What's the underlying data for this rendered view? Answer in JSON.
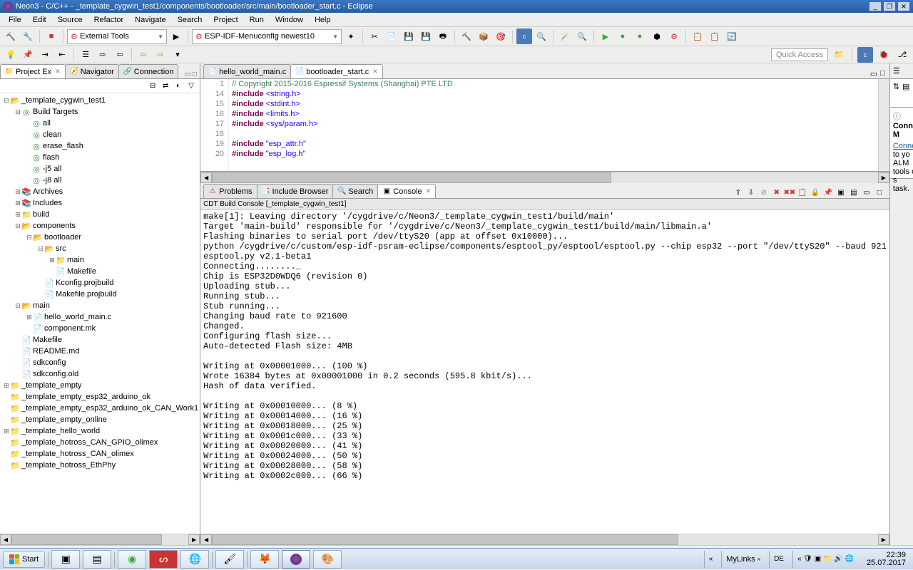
{
  "window": {
    "title": "Neon3 - C/C++ - _template_cygwin_test1/components/bootloader/src/main/bootloader_start.c - Eclipse"
  },
  "menu": [
    "File",
    "Edit",
    "Source",
    "Refactor",
    "Navigate",
    "Search",
    "Project",
    "Run",
    "Window",
    "Help"
  ],
  "toolbar": {
    "external_tools": "External Tools",
    "esp_config": "ESP-IDF-Menuconfig newest10",
    "quick_access": "Quick Access"
  },
  "left_tabs": {
    "project": "Project Ex",
    "navigator": "Navigator",
    "connection": "Connection"
  },
  "tree": {
    "root": "_template_cygwin_test1",
    "build_targets": "Build Targets",
    "targets": [
      "all",
      "clean",
      "erase_flash",
      "flash",
      "-j5 all",
      "-j8 all"
    ],
    "archives": "Archives",
    "includes": "Includes",
    "build": "build",
    "components": "components",
    "bootloader": "bootloader",
    "src": "src",
    "main_dir": "main",
    "makefile": "Makefile",
    "kconfig": "Kconfig.projbuild",
    "makefile_proj": "Makefile.projbuild",
    "main2": "main",
    "hello_c": "hello_world_main.c",
    "component_mk": "component.mk",
    "makefile2": "Makefile",
    "readme": "README.md",
    "sdkconfig": "sdkconfig",
    "sdkconfig_old": "sdkconfig.old",
    "projects": [
      "_template_empty",
      "_template_empty_esp32_arduino_ok",
      "_template_empty_esp32_arduino_ok_CAN_Work1",
      "_template_empty_online",
      "_template_hello_world",
      "_template_hotross_CAN_GPIO_olimex",
      "_template_hotross_CAN_olimex",
      "_template_hotross_EthPhy"
    ]
  },
  "editor_tabs": {
    "t1": "hello_world_main.c",
    "t2": "bootloader_start.c"
  },
  "editor": {
    "lines": [
      {
        "n": "1",
        "type": "cm",
        "text": "// Copyright 2015-2016 Espressif Systems (Shanghai) PTE LTD"
      },
      {
        "n": "14",
        "type": "inc",
        "kw": "#include",
        "arg": "<string.h>"
      },
      {
        "n": "15",
        "type": "inc",
        "kw": "#include",
        "arg": "<stdint.h>"
      },
      {
        "n": "16",
        "type": "inc",
        "kw": "#include",
        "arg": "<limits.h>"
      },
      {
        "n": "17",
        "type": "inc",
        "kw": "#include",
        "arg": "<sys/param.h>"
      },
      {
        "n": "18",
        "type": "blank",
        "text": ""
      },
      {
        "n": "19",
        "type": "inc",
        "kw": "#include",
        "arg": "\"esp_attr.h\""
      },
      {
        "n": "20",
        "type": "inc",
        "kw": "#include",
        "arg": "\"esp_log.h\""
      }
    ]
  },
  "bottom_tabs": {
    "problems": "Problems",
    "include": "Include Browser",
    "search": "Search",
    "console": "Console"
  },
  "console": {
    "header": "CDT Build Console [_template_cygwin_test1]",
    "text": "make[1]: Leaving directory '/cygdrive/c/Neon3/_template_cygwin_test1/build/main'\nTarget 'main-build' responsible for '/cygdrive/c/Neon3/_template_cygwin_test1/build/main/libmain.a'\nFlashing binaries to serial port /dev/ttyS20 (app at offset 0x10000)...\npython /cygdrive/c/custom/esp-idf-psram-eclipse/components/esptool_py/esptool/esptool.py --chip esp32 --port \"/dev/ttyS20\" --baud 921\nesptool.py v2.1-beta1\nConnecting........_\nChip is ESP32D0WDQ6 (revision 0)\nUploading stub...\nRunning stub...\nStub running...\nChanging baud rate to 921600\nChanged.\nConfiguring flash size...\nAuto-detected Flash size: 4MB\n\nWriting at 0x00001000... (100 %)\nWrote 16384 bytes at 0x00001000 in 0.2 seconds (595.8 kbit/s)...\nHash of data verified.\n\nWriting at 0x00010000... (8 %)\nWriting at 0x00014000... (16 %)\nWriting at 0x00018000... (25 %)\nWriting at 0x0001c000... (33 %)\nWriting at 0x00020000... (41 %)\nWriting at 0x00024000... (50 %)\nWriting at 0x00028000... (58 %)\nWriting at 0x0002c000... (66 %)"
  },
  "mylinks": {
    "title": "Connect M",
    "link": "Connect",
    "text1": " to yo",
    "text2": "ALM tools or s",
    "text3": "task."
  },
  "taskbar": {
    "start": "Start",
    "mylinks": "MyLinks",
    "lang": "DE",
    "time": "22:39",
    "date": "25.07.2017"
  }
}
